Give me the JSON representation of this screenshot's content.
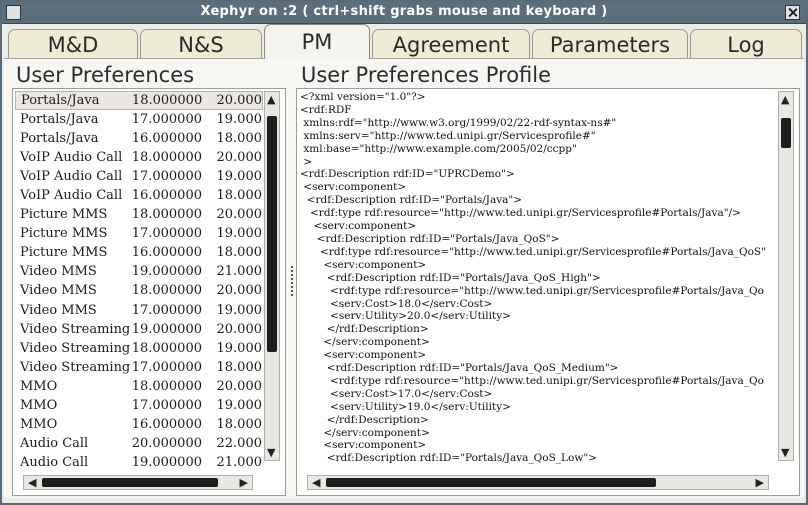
{
  "window": {
    "title": "Xephyr on :2 ( ctrl+shift grabs mouse and keyboard )"
  },
  "tabs": [
    {
      "label": "M&D"
    },
    {
      "label": "N&S"
    },
    {
      "label": "PM"
    },
    {
      "label": "Agreement"
    },
    {
      "label": "Parameters"
    },
    {
      "label": "Log"
    }
  ],
  "active_tab": "PM",
  "preferences": {
    "title": "User Preferences",
    "rows": [
      {
        "name": "Portals/Java",
        "v1": "18.000000",
        "v2": "20.000",
        "selected": true
      },
      {
        "name": "Portals/Java",
        "v1": "17.000000",
        "v2": "19.000"
      },
      {
        "name": "Portals/Java",
        "v1": "16.000000",
        "v2": "18.000"
      },
      {
        "name": "VoIP Audio Call",
        "v1": "18.000000",
        "v2": "20.000"
      },
      {
        "name": "VoIP Audio Call",
        "v1": "17.000000",
        "v2": "19.000"
      },
      {
        "name": "VoIP Audio Call",
        "v1": "16.000000",
        "v2": "18.000"
      },
      {
        "name": "Picture MMS",
        "v1": "18.000000",
        "v2": "20.000"
      },
      {
        "name": "Picture MMS",
        "v1": "17.000000",
        "v2": "19.000"
      },
      {
        "name": "Picture MMS",
        "v1": "16.000000",
        "v2": "18.000"
      },
      {
        "name": "Video MMS",
        "v1": "19.000000",
        "v2": "21.000"
      },
      {
        "name": "Video MMS",
        "v1": "18.000000",
        "v2": "20.000"
      },
      {
        "name": "Video MMS",
        "v1": "17.000000",
        "v2": "19.000"
      },
      {
        "name": "Video Streaming",
        "v1": "19.000000",
        "v2": "20.000"
      },
      {
        "name": "Video Streaming",
        "v1": "18.000000",
        "v2": "19.000"
      },
      {
        "name": "Video Streaming",
        "v1": "17.000000",
        "v2": "18.000"
      },
      {
        "name": "MMO",
        "v1": "18.000000",
        "v2": "20.000"
      },
      {
        "name": "MMO",
        "v1": "17.000000",
        "v2": "19.000"
      },
      {
        "name": "MMO",
        "v1": "16.000000",
        "v2": "18.000"
      },
      {
        "name": "Audio Call",
        "v1": "20.000000",
        "v2": "22.000"
      },
      {
        "name": "Audio Call",
        "v1": "19.000000",
        "v2": "21.000"
      }
    ]
  },
  "profile": {
    "title": "User Preferences Profile",
    "lines": [
      "<?xml version=\"1.0\"?>",
      "<rdf:RDF",
      " xmlns:rdf=\"http://www.w3.org/1999/02/22-rdf-syntax-ns#\"",
      " xmlns:serv=\"http://www.ted.unipi.gr/Servicesprofile#\"",
      " xml:base=\"http://www.example.com/2005/02/ccpp\"",
      " >",
      "<rdf:Description rdf:ID=\"UPRCDemo\">",
      " <serv:component>",
      "  <rdf:Description rdf:ID=\"Portals/Java\">",
      "   <rdf:type rdf:resource=\"http://www.ted.unipi.gr/Servicesprofile#Portals/Java\"/>",
      "    <serv:component>",
      "     <rdf:Description rdf:ID=\"Portals/Java_QoS\">",
      "      <rdf:type rdf:resource=\"http://www.ted.unipi.gr/Servicesprofile#Portals/Java_QoS\"",
      "       <serv:component>",
      "        <rdf:Description rdf:ID=\"Portals/Java_QoS_High\">",
      "         <rdf:type rdf:resource=\"http://www.ted.unipi.gr/Servicesprofile#Portals/Java_Qo",
      "         <serv:Cost>18.0</serv:Cost>",
      "         <serv:Utility>20.0</serv:Utility>",
      "        </rdf:Description>",
      "       </serv:component>",
      "       <serv:component>",
      "        <rdf:Description rdf:ID=\"Portals/Java_QoS_Medium\">",
      "         <rdf:type rdf:resource=\"http://www.ted.unipi.gr/Servicesprofile#Portals/Java_Qo",
      "         <serv:Cost>17.0</serv:Cost>",
      "         <serv:Utility>19.0</serv:Utility>",
      "        </rdf:Description>",
      "       </serv:component>",
      "       <serv:component>",
      "        <rdf:Description rdf:ID=\"Portals/Java_QoS_Low\">"
    ]
  },
  "icons": {
    "window_menu": "window-menu-icon",
    "close": "close-icon",
    "scroll_up": "arrow-up-icon",
    "scroll_down": "arrow-down-icon",
    "scroll_left": "arrow-left-icon",
    "scroll_right": "arrow-right-icon",
    "splitter": "splitter-grip-icon"
  },
  "colors": {
    "titlebar": "#5b6e7c",
    "tab_bg": "#efecd6",
    "panel_bg": "#f6f6f3",
    "selection": "#e9e7df"
  }
}
